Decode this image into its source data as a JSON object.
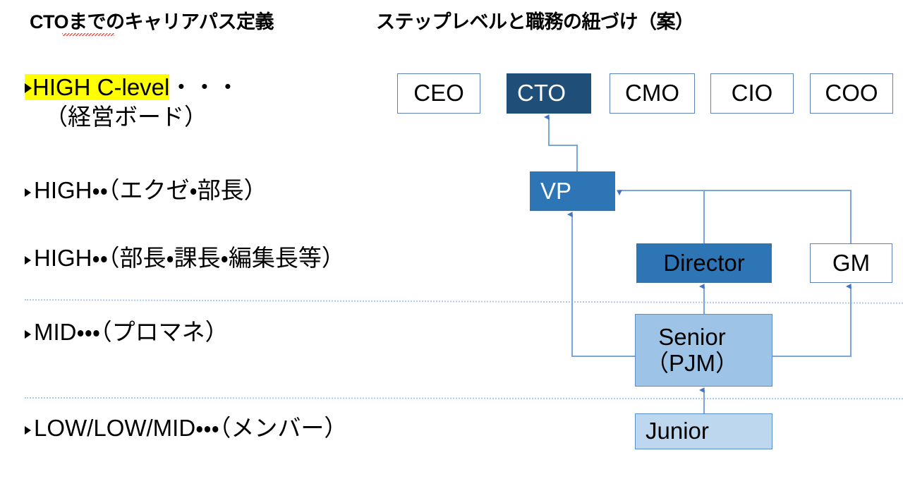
{
  "slide": {
    "heading_main": "CTOまでのキャリアパス定義",
    "heading_sub": "ステップレベルと職務の紐づけ（案）"
  },
  "levels": [
    {
      "id": "c-level",
      "marker": "▶",
      "label": "HIGH C-level",
      "dots": "・・・",
      "sub": "（経営ボード）",
      "highlight_color": "#ffff00",
      "highlighted": true
    },
    {
      "id": "high-exec",
      "marker": "▶",
      "label": "HIGH・・（エクゼ・部長）",
      "highlighted": false
    },
    {
      "id": "high-manager",
      "marker": "▶",
      "label": "HIGH・・（部長・課長・編集長等）",
      "highlighted": false
    },
    {
      "id": "mid",
      "marker": "▶",
      "label": "MID・・・（プロマネ）",
      "highlighted": false
    },
    {
      "id": "low",
      "marker": "▶",
      "label": "LOW/LOW/MID・・・（メンバー）",
      "highlighted": false
    }
  ],
  "chart_data": {
    "type": "diagram",
    "title": "ステップレベルと職務の紐づけ（案）",
    "nodes": [
      {
        "id": "ceo",
        "label": "CEO",
        "fill": "#ffffff",
        "text_color": "#000000",
        "border": "#5b81b5"
      },
      {
        "id": "cto",
        "label": "CTO",
        "fill": "#1f4e79",
        "text_color": "#ffffff",
        "border": "#1f4e79"
      },
      {
        "id": "cmo",
        "label": "CMO",
        "fill": "#ffffff",
        "text_color": "#000000",
        "border": "#5b81b5"
      },
      {
        "id": "cio",
        "label": "CIO",
        "fill": "#ffffff",
        "text_color": "#000000",
        "border": "#5b81b5"
      },
      {
        "id": "coo",
        "label": "COO",
        "fill": "#ffffff",
        "text_color": "#000000",
        "border": "#5b81b5"
      },
      {
        "id": "vp",
        "label": "VP",
        "fill": "#2e75b6",
        "text_color": "#ffffff",
        "border": "#41719c"
      },
      {
        "id": "director",
        "label": "Director",
        "fill": "#2e75b6",
        "text_color": "#000000",
        "border": "#41719c"
      },
      {
        "id": "gm",
        "label": "GM",
        "fill": "#ffffff",
        "text_color": "#000000",
        "border": "#5b81b5"
      },
      {
        "id": "senior",
        "label": "Senior\n（PJM）",
        "fill": "#9dc3e6",
        "text_color": "#000000",
        "border": "#5b8fc9"
      },
      {
        "id": "junior",
        "label": "Junior",
        "fill": "#bdd7ee",
        "text_color": "#000000",
        "border": "#5b8fc9"
      }
    ],
    "edges": [
      {
        "from": "vp",
        "to": "cto"
      },
      {
        "from": "senior",
        "to": "vp"
      },
      {
        "from": "director",
        "to": "vp"
      },
      {
        "from": "gm",
        "to": "vp"
      },
      {
        "from": "senior",
        "to": "director"
      },
      {
        "from": "senior",
        "to": "gm"
      },
      {
        "from": "junior",
        "to": "senior"
      }
    ],
    "edge_color": "#7ba7d7",
    "dividers": 2
  }
}
